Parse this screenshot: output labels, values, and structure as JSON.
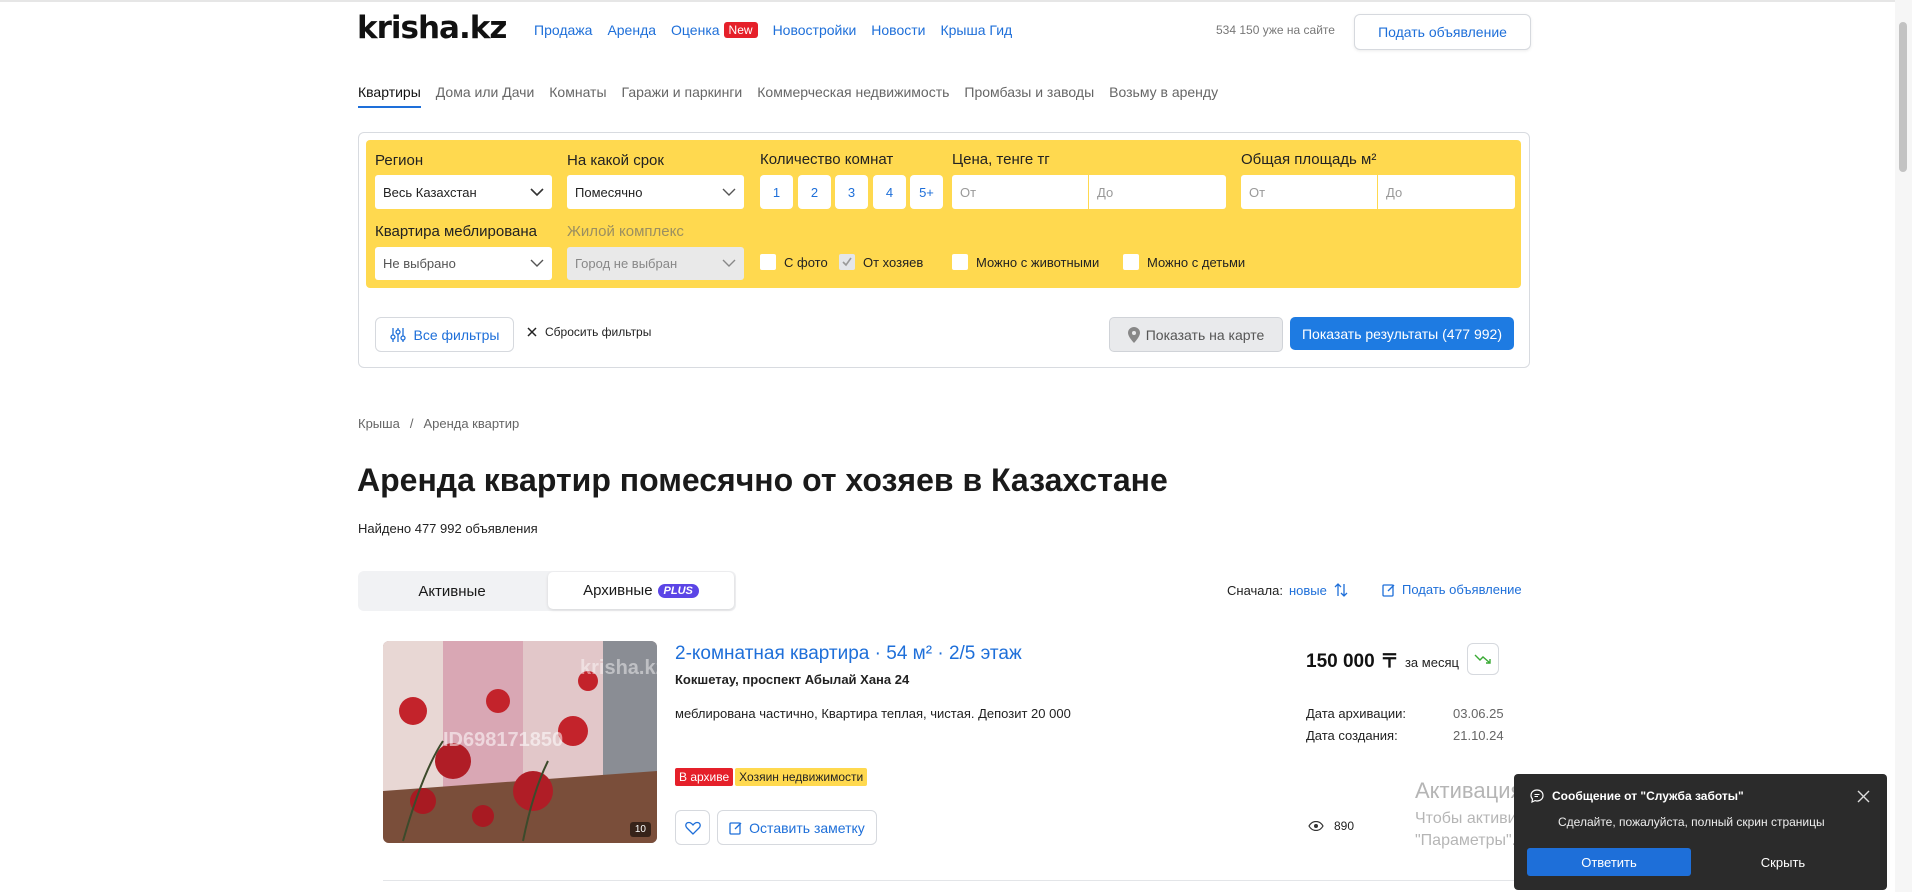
{
  "header": {
    "logo": "krisha.kz",
    "nav": [
      {
        "label": "Продажа",
        "red": false
      },
      {
        "label": "Аренда",
        "red": true
      },
      {
        "label": "Оценка",
        "red": false,
        "badge": "New"
      },
      {
        "label": "Новостройки",
        "red": false
      },
      {
        "label": "Новости",
        "red": false
      },
      {
        "label": "Крыша Гид",
        "red": false
      }
    ],
    "online": "534 150 уже на сайте",
    "post_button": "Подать объявление"
  },
  "categories": [
    "Квартиры",
    "Дома или Дачи",
    "Комнаты",
    "Гаражи и паркинги",
    "Коммерческая недвижимость",
    "Промбазы и заводы",
    "Возьму в аренду"
  ],
  "filter": {
    "region_label": "Регион",
    "region_value": "Весь Казахстан",
    "term_label": "На какой срок",
    "term_value": "Помесячно",
    "rooms_label": "Количество комнат",
    "rooms": [
      "1",
      "2",
      "3",
      "4",
      "5+"
    ],
    "price_label": "Цена, тенге тг",
    "price_from": "От",
    "price_to": "До",
    "area_label": "Общая площадь м²",
    "area_from": "От",
    "area_to": "До",
    "furnished_label": "Квартира меблирована",
    "furnished_value": "Не выбрано",
    "complex_label": "Жилой комплекс",
    "complex_value": "Город не выбран",
    "checkboxes": [
      {
        "label": "С фото",
        "checked": false
      },
      {
        "label": "От хозяев",
        "checked": true
      },
      {
        "label": "Можно с животными",
        "checked": false
      },
      {
        "label": "Можно с детьми",
        "checked": false
      }
    ],
    "all_filters": "Все фильтры",
    "reset": "Сбросить фильтры",
    "show_map": "Показать на карте",
    "show_results": "Показать результаты (477 992)"
  },
  "breadcrumb": [
    "Крыша",
    "/",
    "Аренда квартир"
  ],
  "page_title": "Аренда квартир помесячно от хозяев в Казахстане",
  "found": "Найдено 477 992 объявления",
  "tabs": {
    "active": "Активные",
    "archive": "Архивные",
    "plus": "PLUS"
  },
  "sort": {
    "label": "Сначала:",
    "value": "новые"
  },
  "post_ad_link": "Подать объявление",
  "listing": {
    "title": "2-комнатная квартира · 54 м² · 2/5 этаж",
    "address": "Кокшетау, проспект Абылай Хана 24",
    "description": "меблирована частично, Квартира теплая, чистая. Депозит 20 000",
    "price": "150 000 〒",
    "price_suffix": "за месяц",
    "archived_label": "Дата архивации:",
    "archived_value": "03.06.25",
    "created_label": "Дата создания:",
    "created_value": "21.10.24",
    "tag_archive": "В архиве",
    "tag_owner": "Хозяин недвижимости",
    "note_button": "Оставить заметку",
    "views": "890",
    "photo_count": "10",
    "photo_watermark": "ID698171850",
    "photo_brand": "krisha.kz"
  },
  "windows_watermark": {
    "line1": "Активация Windows",
    "line2": "Чтобы активировать Windows, перейдите в раздел",
    "line3": "\"Параметры\"."
  },
  "notification": {
    "title": "Сообщение от \"Служба заботы\"",
    "body": "Сделайте, пожалуйста, полный скрин страницы",
    "reply": "Ответить",
    "hide": "Скрыть"
  }
}
